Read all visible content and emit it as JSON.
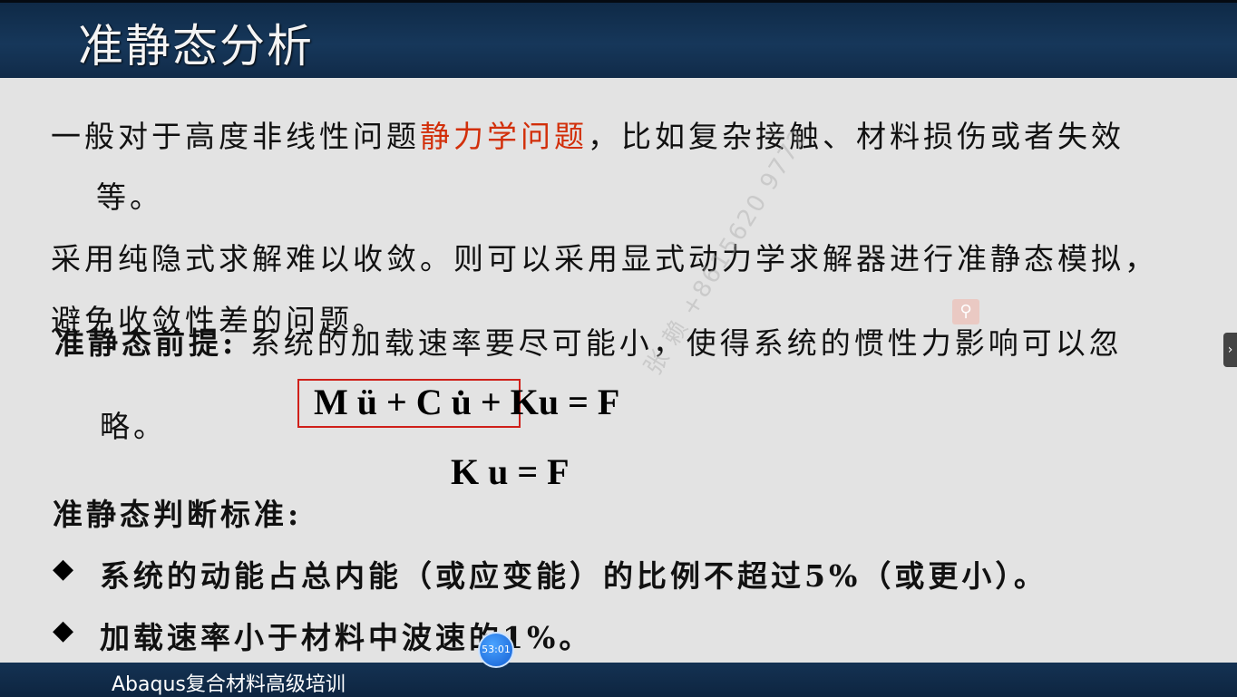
{
  "header": {
    "title": "准静态分析"
  },
  "body": {
    "line1_prefix": "一般对于高度非线性问题",
    "line1_highlight": "静力学问题",
    "line1_suffix": "，比如复杂接触、材料损伤或者失效",
    "line1_cont": "等。",
    "line2": "采用纯隐式求解难以收敛。则可以采用显式动力学求解器进行准静态模拟，",
    "line3": "避免收敛性差的问题。",
    "premise_label": "准静态前提:",
    "premise_text": "系统的加载速率要尽可能小，使得系统的惯性力影响可以忽",
    "premise_cont": "略。",
    "equation1": "M ü + C u̇ + Ku  =  F",
    "equation2": "K u  =  F",
    "criteria_title": "准静态判断标准:",
    "bullets": [
      "系统的动能占总内能（或应变能）的比例不超过5%（或更小）。",
      "加载速率小于材料中波速的1%。"
    ]
  },
  "footer": {
    "text": "Abaqus复合材料高级培训"
  },
  "overlay": {
    "watermark": "张 赖 +8615620 9772",
    "timer": "53:01",
    "search_icon": "search-icon",
    "side_arrow": "›"
  },
  "colors": {
    "highlight": "#d22f0a",
    "header_bg": "#16375a",
    "box": "#d0201a"
  }
}
